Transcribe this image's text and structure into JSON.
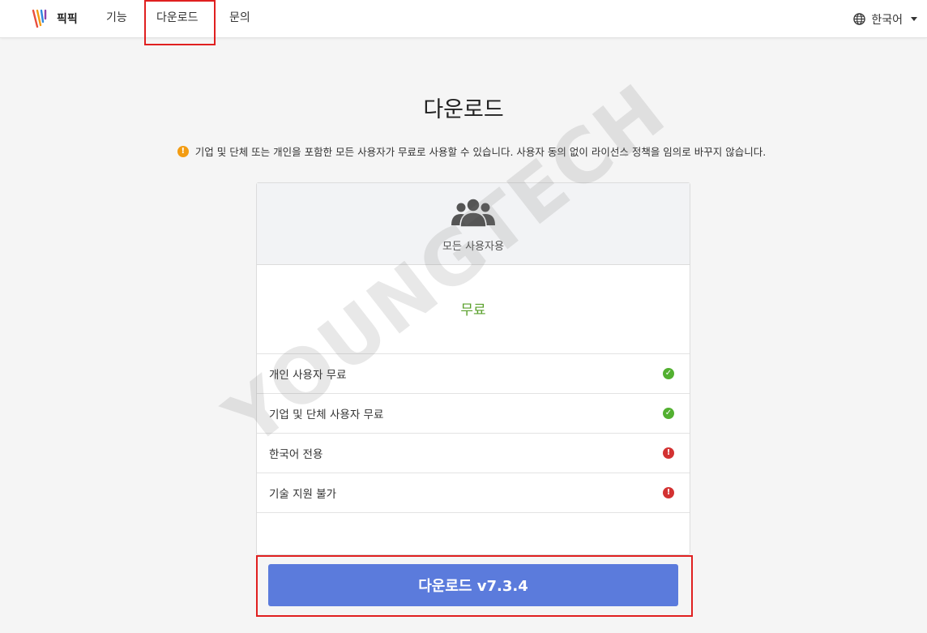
{
  "header": {
    "brand": "픽픽",
    "nav": {
      "features": "기능",
      "download": "다운로드",
      "contact": "문의"
    },
    "language": "한국어",
    "icons": [
      "picpick-logo-icon",
      "globe-icon",
      "chevron-down-icon"
    ]
  },
  "main": {
    "title": "다운로드",
    "notice": "기업 및 단체 또는 개인을 포함한 모든 사용자가 무료로 사용할 수 있습니다. 사용자 동의 없이 라이선스 정책을 임의로 바꾸지 않습니다.",
    "card": {
      "icon": "users-icon",
      "plan_name": "모든 사용자용",
      "price": "무료",
      "features": [
        {
          "label": "개인 사용자 무료",
          "status": "check-circle-icon",
          "color": "#52b030"
        },
        {
          "label": "기업 및 단체 사용자 무료",
          "status": "check-circle-icon",
          "color": "#52b030"
        },
        {
          "label": "한국어 전용",
          "status": "exclamation-circle-icon",
          "color": "#d33232"
        },
        {
          "label": "기술 지원 불가",
          "status": "exclamation-circle-icon",
          "color": "#d33232"
        }
      ]
    },
    "download_button": "다운로드 v7.3.4"
  },
  "watermark": "YOUNGTECH",
  "colors": {
    "accent_button": "#5b7bdc",
    "free_text": "#5aa02c",
    "highlight_box": "#e02020",
    "notice_icon": "#f39c12"
  }
}
